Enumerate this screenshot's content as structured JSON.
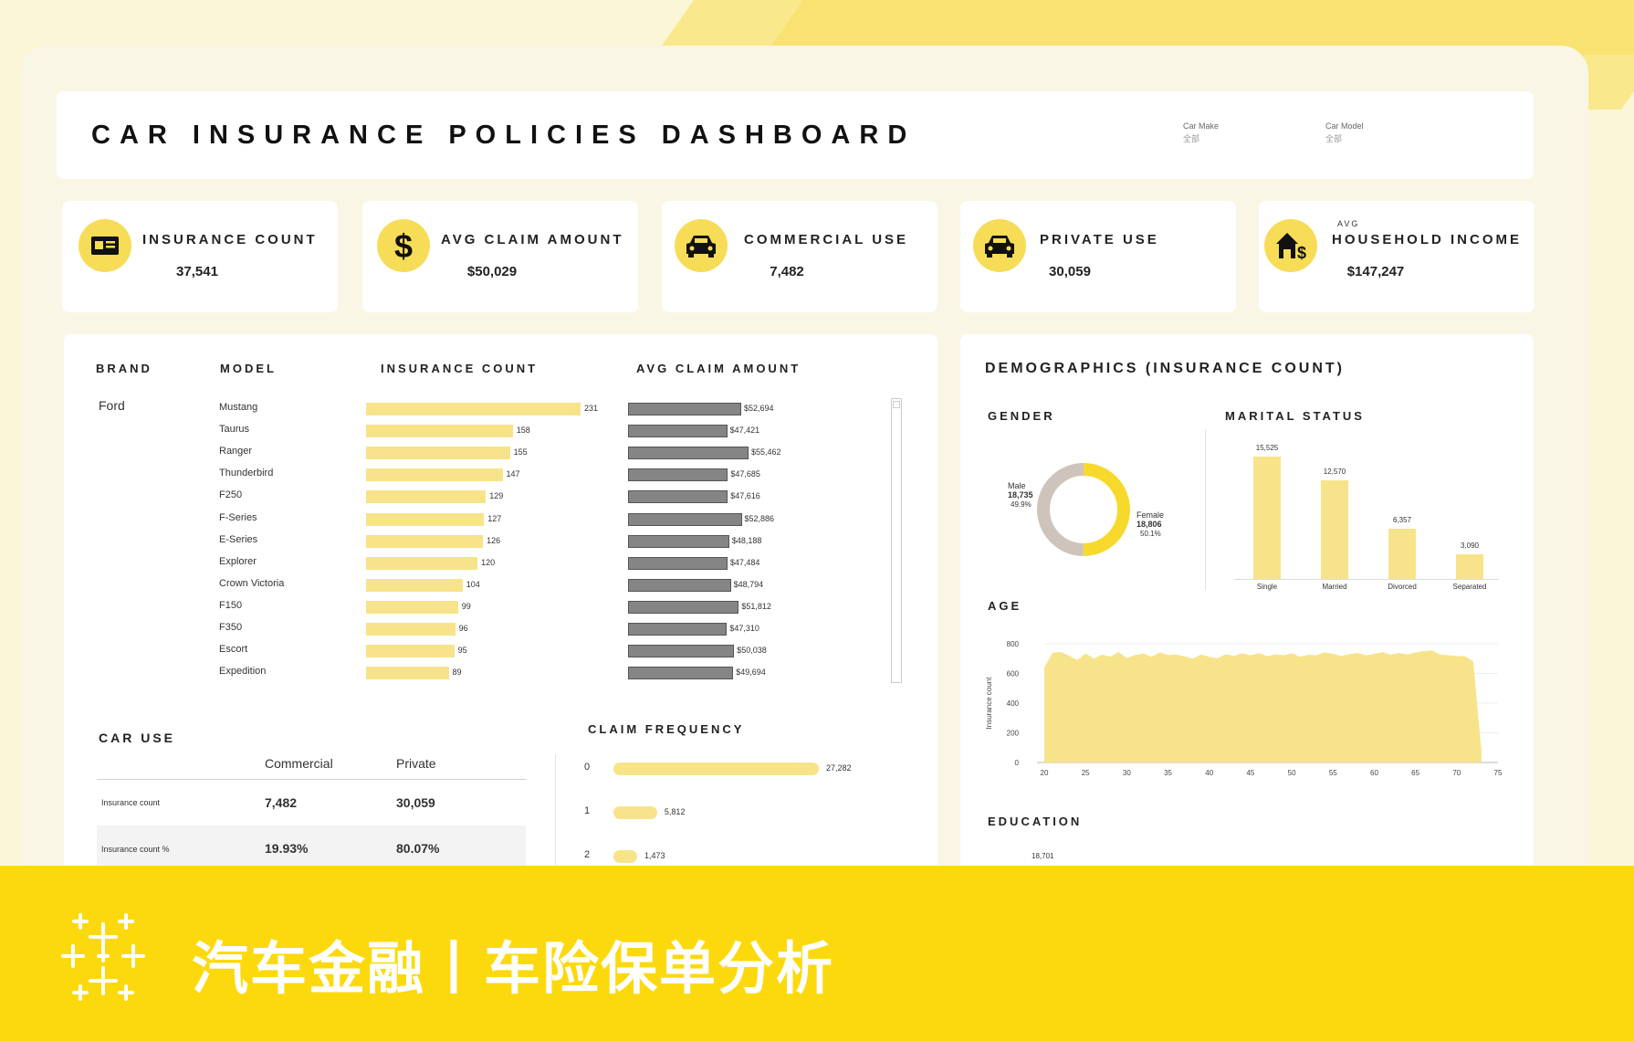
{
  "header": {
    "title": "CAR INSURANCE POLICIES DASHBOARD",
    "filters": [
      {
        "label": "Car Make",
        "value": "全部"
      },
      {
        "label": "Car Model",
        "value": "全部"
      }
    ]
  },
  "kpis": [
    {
      "icon": "id-card-icon",
      "sub": "",
      "label": "INSURANCE COUNT",
      "value": "37,541"
    },
    {
      "icon": "dollar-icon",
      "sub": "",
      "label": "AVG CLAIM AMOUNT",
      "value": "$50,029"
    },
    {
      "icon": "car-icon",
      "sub": "",
      "label": "COMMERCIAL USE",
      "value": "7,482"
    },
    {
      "icon": "car-icon",
      "sub": "",
      "label": "PRIVATE USE",
      "value": "30,059"
    },
    {
      "icon": "house-dollar-icon",
      "sub": "AVG",
      "label": "HOUSEHOLD INCOME",
      "value": "$147,247"
    }
  ],
  "models_table": {
    "headers": {
      "brand": "BRAND",
      "model": "MODEL",
      "count": "INSURANCE COUNT",
      "claim": "AVG CLAIM AMOUNT"
    },
    "brand": "Ford"
  },
  "car_use": {
    "title": "CAR USE",
    "columns": [
      "Commercial",
      "Private"
    ],
    "rows": [
      {
        "label": "Insurance count",
        "values": [
          "7,482",
          "30,059"
        ]
      },
      {
        "label": "Insurance count %",
        "values": [
          "19.93%",
          "80.07%"
        ]
      }
    ]
  },
  "demographics": {
    "title": "DEMOGRAPHICS (INSURANCE COUNT)",
    "gender_title": "GENDER",
    "gender": [
      {
        "name": "Male",
        "count": "18,735",
        "pct": "49.9%",
        "value": 49.9,
        "color": "#cfc4bc"
      },
      {
        "name": "Female",
        "count": "18,806",
        "pct": "50.1%",
        "value": 50.1,
        "color": "#f7d92c"
      }
    ],
    "marital_title": "MARITAL STATUS",
    "age_title": "AGE",
    "age_ylabel": "Insurance count",
    "education_title": "EDUCATION",
    "education_first_value": "18,701"
  },
  "claim_frequency": {
    "title": "CLAIM FREQUENCY"
  },
  "footer": {
    "text": "汽车金融丨车险保单分析"
  },
  "colors": {
    "accent": "#f7dc58",
    "bar": "#f7e48a",
    "claim_bar": "#858585",
    "footer": "#fcd90c"
  },
  "chart_data": [
    {
      "type": "bar",
      "orientation": "horizontal",
      "title": "INSURANCE COUNT",
      "categories": [
        "Mustang",
        "Taurus",
        "Ranger",
        "Thunderbird",
        "F250",
        "F-Series",
        "E-Series",
        "Explorer",
        "Crown Victoria",
        "F150",
        "F350",
        "Escort",
        "Expedition"
      ],
      "values": [
        231,
        158,
        155,
        147,
        129,
        127,
        126,
        120,
        104,
        99,
        96,
        95,
        89
      ]
    },
    {
      "type": "bar",
      "orientation": "horizontal",
      "title": "AVG CLAIM AMOUNT",
      "categories": [
        "Mustang",
        "Taurus",
        "Ranger",
        "Thunderbird",
        "F250",
        "F-Series",
        "E-Series",
        "Explorer",
        "Crown Victoria",
        "F150",
        "F350",
        "Escort",
        "Expedition"
      ],
      "values": [
        52694,
        47421,
        55462,
        47685,
        47616,
        52886,
        48188,
        47484,
        48794,
        51812,
        47310,
        50038,
        49694
      ],
      "labels": [
        "$52,694",
        "$47,421",
        "$55,462",
        "$47,685",
        "$47,616",
        "$52,886",
        "$48,188",
        "$47,484",
        "$48,794",
        "$51,812",
        "$47,310",
        "$50,038",
        "$49,694"
      ]
    },
    {
      "type": "bar",
      "orientation": "horizontal",
      "title": "CLAIM FREQUENCY",
      "categories": [
        "0",
        "1",
        "2"
      ],
      "values": [
        27282,
        5812,
        1473
      ],
      "labels": [
        "27,282",
        "5,812",
        "1,473"
      ]
    },
    {
      "type": "pie",
      "title": "GENDER",
      "categories": [
        "Male",
        "Female"
      ],
      "values": [
        18735,
        18806
      ]
    },
    {
      "type": "bar",
      "title": "MARITAL STATUS",
      "categories": [
        "Single",
        "Married",
        "Divorced",
        "Separated"
      ],
      "values": [
        15525,
        12570,
        6357,
        3090
      ],
      "labels": [
        "15,525",
        "12,570",
        "6,357",
        "3,090"
      ]
    },
    {
      "type": "area",
      "title": "AGE",
      "ylabel": "Insurance count",
      "xlim": [
        20,
        75
      ],
      "ylim": [
        0,
        800
      ],
      "xticks": [
        20,
        25,
        30,
        35,
        40,
        45,
        50,
        55,
        60,
        65,
        70,
        75
      ],
      "yticks": [
        0,
        200,
        400,
        600,
        800
      ],
      "x": [
        20,
        21,
        22,
        23,
        24,
        25,
        26,
        27,
        28,
        29,
        30,
        31,
        32,
        33,
        34,
        35,
        36,
        37,
        38,
        39,
        40,
        41,
        42,
        43,
        44,
        45,
        46,
        47,
        48,
        49,
        50,
        51,
        52,
        53,
        54,
        55,
        56,
        57,
        58,
        59,
        60,
        61,
        62,
        63,
        64,
        65,
        66,
        67,
        68,
        69,
        70,
        71,
        72,
        73
      ],
      "y": [
        640,
        740,
        745,
        720,
        690,
        735,
        700,
        728,
        712,
        745,
        705,
        725,
        735,
        712,
        742,
        725,
        728,
        715,
        700,
        728,
        712,
        702,
        730,
        718,
        736,
        722,
        738,
        716,
        728,
        722,
        736,
        712,
        726,
        722,
        742,
        732,
        718,
        730,
        738,
        722,
        732,
        744,
        726,
        738,
        728,
        742,
        750,
        755,
        728,
        722,
        718,
        716,
        682,
        70
      ]
    }
  ]
}
